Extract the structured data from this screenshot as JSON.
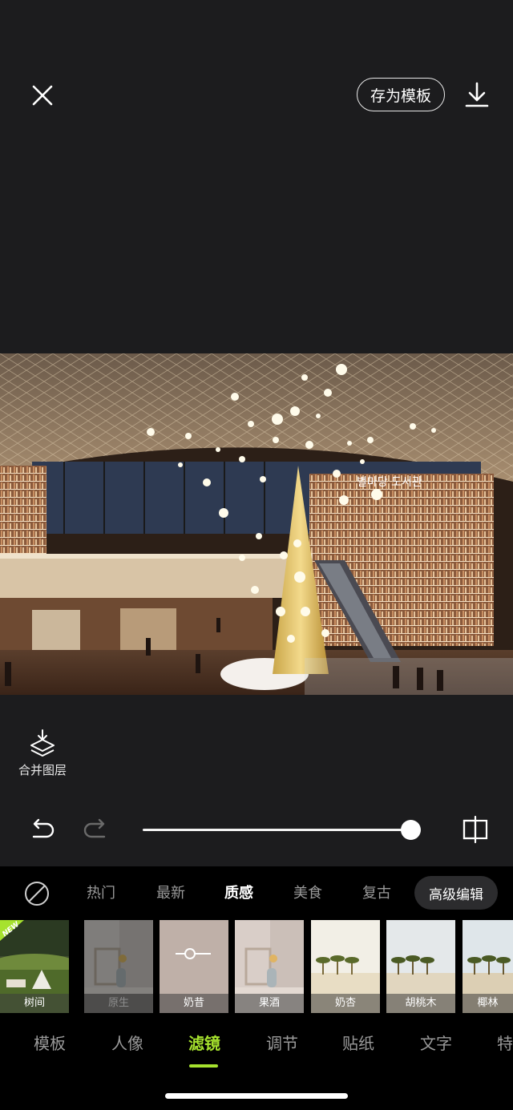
{
  "topbar": {
    "save_template": "存为模板"
  },
  "merge_layers": "合并图层",
  "photo": {
    "sign_text": "별마당 도서관"
  },
  "slider": {
    "value": 100
  },
  "categories": [
    {
      "label": "热门"
    },
    {
      "label": "最新"
    },
    {
      "label": "质感",
      "active": true
    },
    {
      "label": "美食"
    },
    {
      "label": "复古"
    },
    {
      "label": "高级编辑"
    }
  ],
  "filters": [
    {
      "label": "树间",
      "badge": "NEW"
    },
    {
      "label": "原生"
    },
    {
      "label": "奶昔"
    },
    {
      "label": "果酒"
    },
    {
      "label": "奶杏"
    },
    {
      "label": "胡桃木"
    },
    {
      "label": "椰林"
    }
  ],
  "tabs": [
    {
      "label": "模板"
    },
    {
      "label": "人像"
    },
    {
      "label": "滤镜",
      "active": true
    },
    {
      "label": "调节"
    },
    {
      "label": "贴纸"
    },
    {
      "label": "文字"
    },
    {
      "label": "特"
    }
  ],
  "colors": {
    "accent": "#a6e22e",
    "background": "#1c1c1e",
    "panel": "#000000"
  }
}
